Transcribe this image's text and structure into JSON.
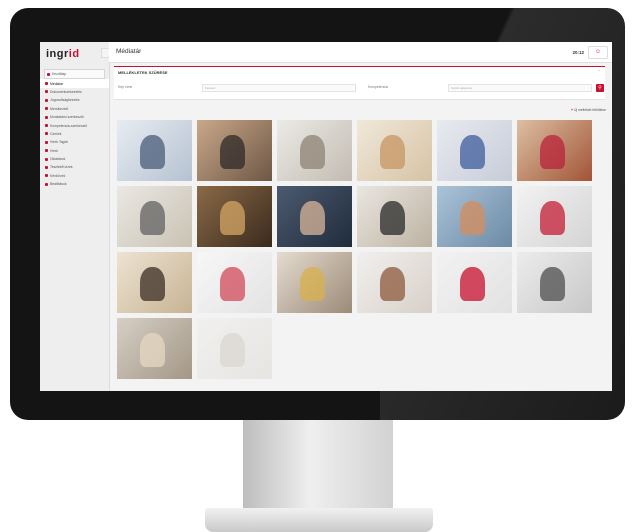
{
  "app": {
    "logo_main": "ingr",
    "logo_accent": "id",
    "page_title": "Médiatár",
    "clock": "20:12",
    "user_icon": "user-icon"
  },
  "sidebar": {
    "items": [
      {
        "label": "Kezdőlap",
        "icon": "home-icon"
      },
      {
        "label": "Médiatár",
        "icon": "media-icon",
        "active": true
      },
      {
        "label": "Dokumentumkezelés",
        "icon": "document-icon"
      },
      {
        "label": "Jogosultságkezelés",
        "icon": "key-icon"
      },
      {
        "label": "Menükezelő",
        "icon": "menu-icon"
      },
      {
        "label": "Munkatársi szerkesztő",
        "icon": "user-icon"
      },
      {
        "label": "Kompetencia-szerkesztő",
        "icon": "star-icon"
      },
      {
        "label": "Címkék",
        "icon": "tag-icon"
      },
      {
        "label": "Hírek Tagek",
        "icon": "news-icon"
      },
      {
        "label": "Hírek",
        "icon": "news-icon"
      },
      {
        "label": "Oktatások",
        "icon": "check-icon"
      },
      {
        "label": "Tesztek/Kvízek",
        "icon": "quiz-icon"
      },
      {
        "label": "Kérdőívek",
        "icon": "form-icon"
      },
      {
        "label": "Beállítások",
        "icon": "gear-icon"
      }
    ]
  },
  "filter": {
    "title": "MELLÉKLETEK SZŰRÉSE",
    "fields": [
      {
        "label": "Kép címe",
        "placeholder": "Keresés"
      },
      {
        "label": "Kompetencia",
        "placeholder": "Kérjük válasszon"
      }
    ],
    "search_icon": "search-icon"
  },
  "actions": {
    "new_label": "Új melléklet feltöltése"
  },
  "gallery": {
    "count": 20,
    "images": [
      {
        "colors": [
          "#e7ecf2",
          "#b6c2d1"
        ],
        "accent": "#4a5c78"
      },
      {
        "colors": [
          "#c9a889",
          "#6e5746"
        ],
        "accent": "#2f2a28"
      },
      {
        "colors": [
          "#eceae6",
          "#c2bcb2"
        ],
        "accent": "#8d8374"
      },
      {
        "colors": [
          "#f0e8da",
          "#d6c3a4"
        ],
        "accent": "#c69563"
      },
      {
        "colors": [
          "#e8eaf0",
          "#c7ccd8"
        ],
        "accent": "#3d5d9c"
      },
      {
        "colors": [
          "#dcbfa3",
          "#a25436"
        ],
        "accent": "#b8233a"
      },
      {
        "colors": [
          "#eae8e3",
          "#c9c2b4"
        ],
        "accent": "#626262"
      },
      {
        "colors": [
          "#8a6a47",
          "#3a2a1d"
        ],
        "accent": "#d4a564"
      },
      {
        "colors": [
          "#4c5a70",
          "#202c3c"
        ],
        "accent": "#d9b59a"
      },
      {
        "colors": [
          "#e9e6e1",
          "#bdb2a1"
        ],
        "accent": "#2a2a2a"
      },
      {
        "colors": [
          "#aac3d8",
          "#6c8aa5"
        ],
        "accent": "#d68c5e"
      },
      {
        "colors": [
          "#f2f2f2",
          "#d4d4d4"
        ],
        "accent": "#c41e35"
      },
      {
        "colors": [
          "#ede3d2",
          "#c7b393"
        ],
        "accent": "#3b2d24"
      },
      {
        "colors": [
          "#f7f7f7",
          "#e3e3e3"
        ],
        "accent": "#d04a5a"
      },
      {
        "colors": [
          "#e4dcd0",
          "#9c8a77"
        ],
        "accent": "#d8b04c"
      },
      {
        "colors": [
          "#f1f0ef",
          "#d8d0c8"
        ],
        "accent": "#8e5a3c"
      },
      {
        "colors": [
          "#f2f2f2",
          "#e2e2e2"
        ],
        "accent": "#c8102e"
      },
      {
        "colors": [
          "#ececec",
          "#c8c8c8"
        ],
        "accent": "#4d4d4d"
      },
      {
        "colors": [
          "#d6cfc5",
          "#a39786"
        ],
        "accent": "#e6d8c2"
      },
      {
        "colors": [
          "#f0efec",
          "#dcdad4"
        ],
        "accent": "#c7c1b7"
      }
    ]
  }
}
